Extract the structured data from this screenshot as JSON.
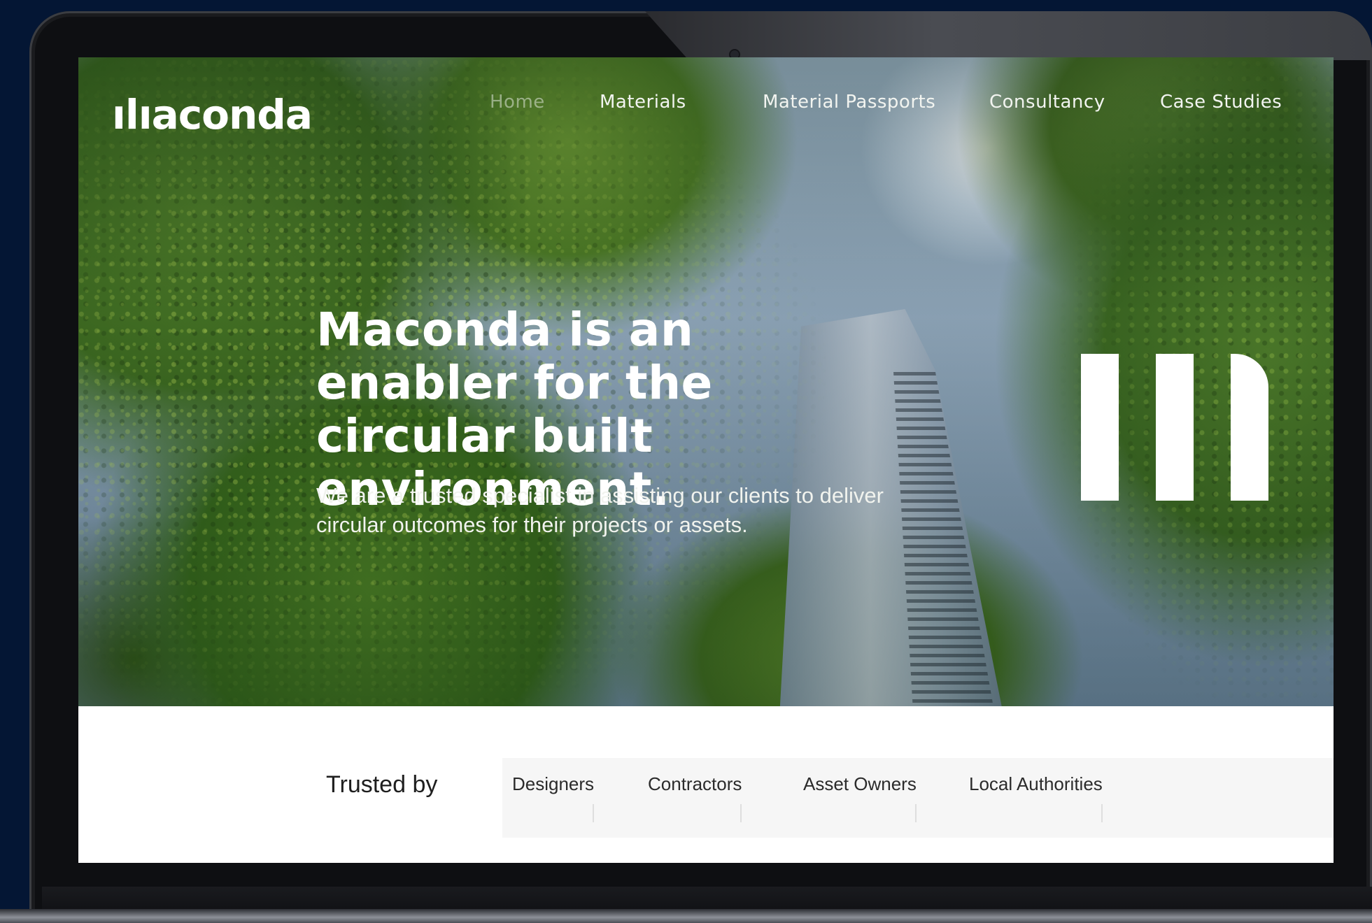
{
  "site": {
    "logo": "ılıaconda"
  },
  "nav": {
    "items": [
      {
        "label": "Home",
        "state": "faded"
      },
      {
        "label": "Materials",
        "state": "normal"
      },
      {
        "label": "Material Passports",
        "state": "normal"
      },
      {
        "label": "Consultancy",
        "state": "normal"
      },
      {
        "label": "Case Studies",
        "state": "normal"
      }
    ]
  },
  "hero": {
    "heading": "Maconda is an enabler for the circular built environment.",
    "subheading": "We are a trusted specialist in assisting our clients to deliver circular outcomes for their projects or assets.",
    "mark_icon": "maconda-m-icon"
  },
  "trusted": {
    "label": "Trusted by",
    "tabs": [
      "Designers",
      "Contractors",
      "Asset Owners",
      "Local Authorities"
    ]
  },
  "colors": {
    "page_background": "#041634",
    "hero_text": "#ffffff",
    "band_background": "#ffffff",
    "tab_strip": "#f6f6f6"
  }
}
